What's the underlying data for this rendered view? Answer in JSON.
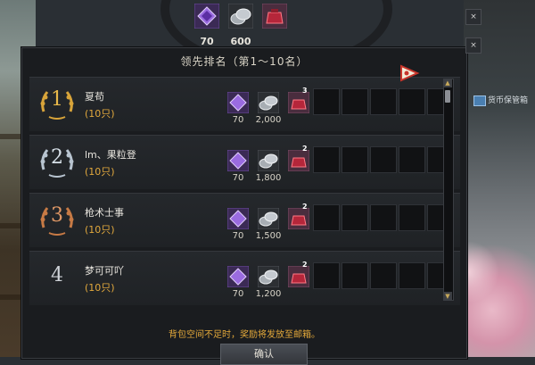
{
  "top_reward": {
    "items": [
      {
        "icon": "purple-crystal-icon",
        "value": "70"
      },
      {
        "icon": "silver-coin-icon",
        "value": "600"
      },
      {
        "icon": "red-pouch-icon",
        "value": ""
      }
    ]
  },
  "panel": {
    "title": "领先排名（第1～10名）",
    "notice": "背包空间不足时，奖励将发放至邮箱。",
    "confirm_label": "确认"
  },
  "ranking": [
    {
      "rank": "1",
      "name": "夏苟",
      "count": "(10只)",
      "crystal": "70",
      "coins": "2,000",
      "pouch": "3"
    },
    {
      "rank": "2",
      "name": "lm、果粒登",
      "count": "(10只)",
      "crystal": "70",
      "coins": "1,800",
      "pouch": "2"
    },
    {
      "rank": "3",
      "name": "枪术士事",
      "count": "(10只)",
      "crystal": "70",
      "coins": "1,500",
      "pouch": "2"
    },
    {
      "rank": "4",
      "name": "梦可可吖",
      "count": "(10只)",
      "crystal": "70",
      "coins": "1,200",
      "pouch": "2"
    }
  ],
  "side": {
    "trade_label": "货币保管箱",
    "btn_x": "×",
    "btn_y": "×"
  },
  "colors": {
    "gold": "#d8a43a",
    "silver": "#b8c4d0",
    "bronze": "#c77a45",
    "notice": "#e4a93a"
  }
}
